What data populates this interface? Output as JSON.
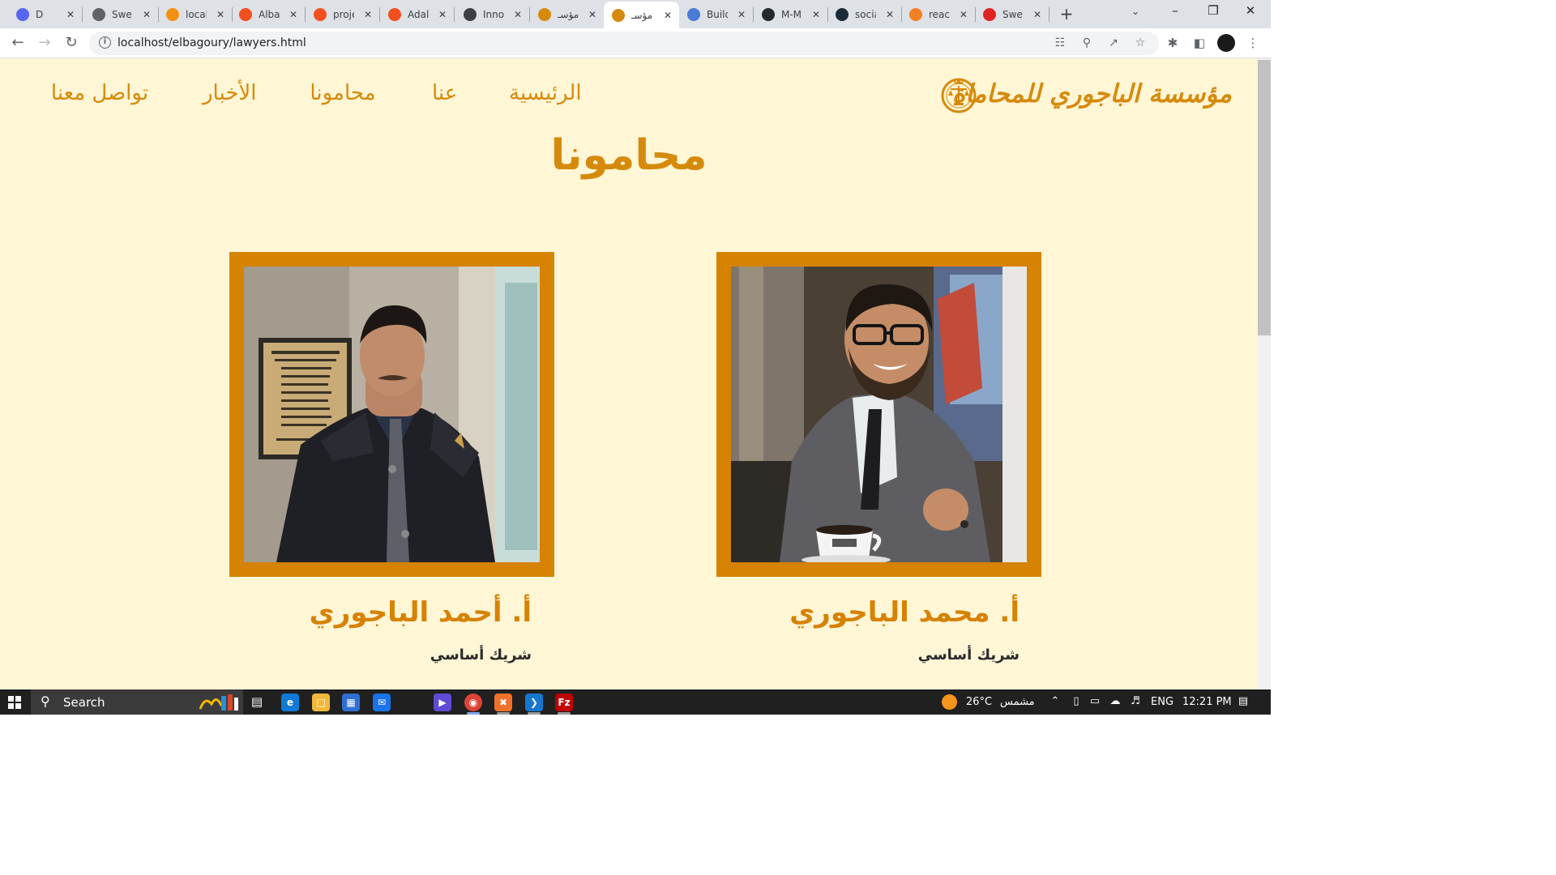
{
  "browser": {
    "tabs": [
      {
        "title": "D",
        "favicon": "discord-icon",
        "color": "#5865f2"
      },
      {
        "title": "Swe",
        "favicon": "globe-icon",
        "color": "#5f6368"
      },
      {
        "title": "local",
        "favicon": "phpmyadmin-icon",
        "color": "#f29111"
      },
      {
        "title": "Alba",
        "favicon": "figma-icon",
        "color": "#f24e1e"
      },
      {
        "title": "proje",
        "favicon": "figma-icon",
        "color": "#f24e1e"
      },
      {
        "title": "Adal",
        "favicon": "figma-icon",
        "color": "#f24e1e"
      },
      {
        "title": "Inno",
        "favicon": "house-icon",
        "color": "#3c4043"
      },
      {
        "title": "مؤسـ",
        "favicon": "scale-icon",
        "color": "#d68a0b"
      },
      {
        "title": "مؤسـ",
        "favicon": "scale-icon",
        "color": "#d68a0b",
        "active": true
      },
      {
        "title": "Build",
        "favicon": "react-icon",
        "color": "#4a7bd6"
      },
      {
        "title": "M-M",
        "favicon": "github-icon",
        "color": "#24292f"
      },
      {
        "title": "socia",
        "favicon": "react-icon",
        "color": "#1b2b3a"
      },
      {
        "title": "react",
        "favicon": "stackoverflow-icon",
        "color": "#f48024"
      },
      {
        "title": "Swe",
        "favicon": "vivaldi-icon",
        "color": "#e02424"
      }
    ],
    "url": "localhost/elbagoury/lawyers.html"
  },
  "site": {
    "logo_text": "مؤسسة الباجوري للمحاماة",
    "nav": {
      "home": "الرئيسية",
      "about": "عنا",
      "lawyers": "محامونا",
      "news": "الأخبار",
      "contact": "تواصل معنا"
    },
    "page_title": "محامونا",
    "accent_color": "#d68202",
    "background_color": "#fff6d6",
    "lawyers": [
      {
        "name": "أ. محمد الباجوري",
        "role": "شريك أساسي"
      },
      {
        "name": "أ. أحمد الباجوري",
        "role": "شريك أساسي"
      }
    ]
  },
  "taskbar": {
    "search_label": "Search",
    "weather_temp": "26°C",
    "weather_desc": "مشمس",
    "language": "ENG",
    "time": "12:21 PM"
  }
}
